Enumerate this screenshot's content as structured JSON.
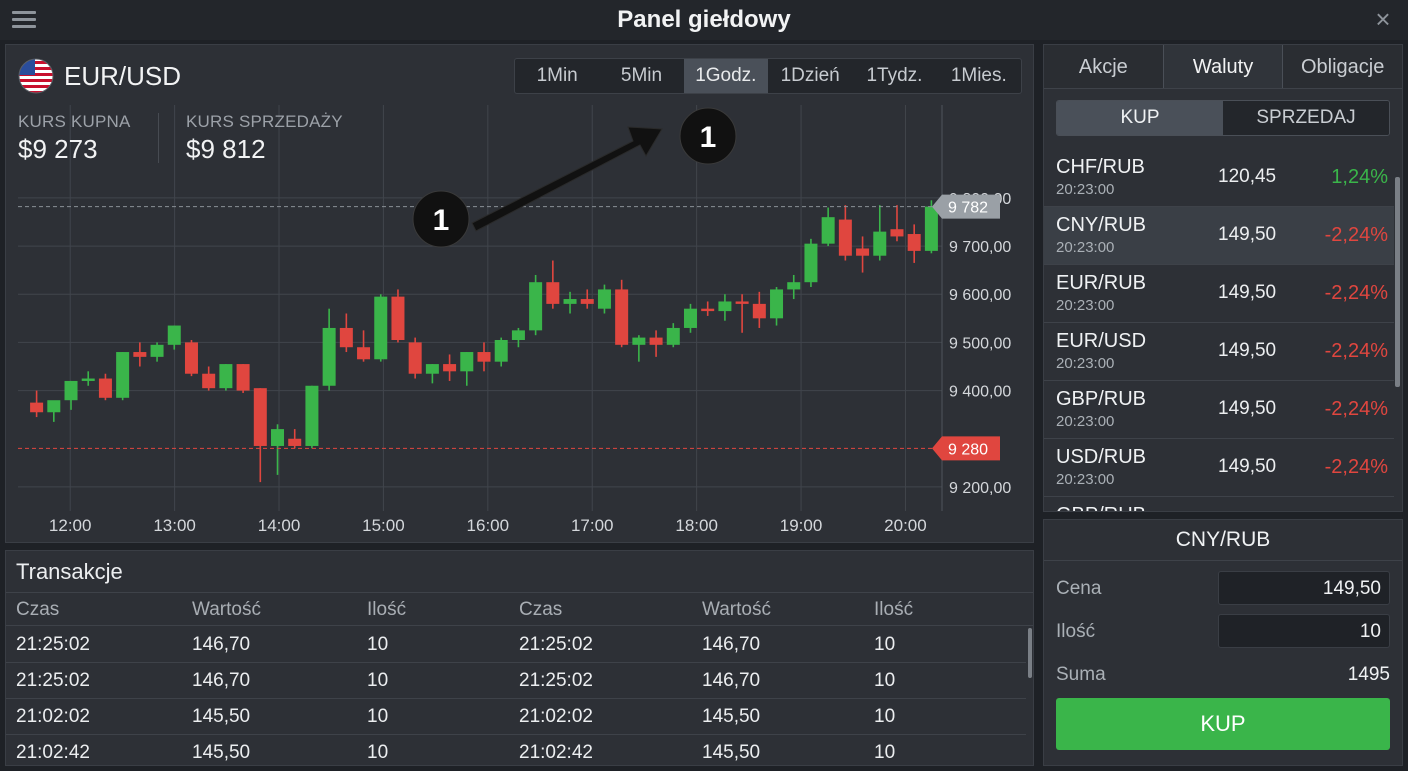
{
  "app": {
    "title": "Panel giełdowy"
  },
  "colors": {
    "up": "#3ab54a",
    "down": "#e0463f",
    "grid": "#41454c",
    "label_bg": "#9aa0a6",
    "callout": "#111111"
  },
  "chart_panel": {
    "pair": "EUR/USD",
    "timeframes": [
      {
        "label": "1Min",
        "active": false
      },
      {
        "label": "5Min",
        "active": false
      },
      {
        "label": "1Godz.",
        "active": true
      },
      {
        "label": "1Dzień",
        "active": false
      },
      {
        "label": "1Tydz.",
        "active": false
      },
      {
        "label": "1Mies.",
        "active": false
      }
    ],
    "buy_rate_label": "KURS KUPNA",
    "buy_rate_value": "$9 273",
    "sell_rate_label": "KURS SPRZEDAŻY",
    "sell_rate_value": "$9 812"
  },
  "chart_data": {
    "type": "candlestick",
    "x_labels": [
      "12:00",
      "13:00",
      "14:00",
      "15:00",
      "16:00",
      "17:00",
      "18:00",
      "19:00",
      "20:00"
    ],
    "y_ticks": [
      "9 800,00",
      "9 700,00",
      "9 600,00",
      "9 500,00",
      "9 400,00",
      "9 200,00"
    ],
    "y_tick_values": [
      9800,
      9700,
      9600,
      9500,
      9400,
      9200
    ],
    "ylim": [
      9150,
      9860
    ],
    "x_start_hour": 11.5,
    "x_end_hour": 20.35,
    "price_markers": [
      {
        "label": "9 782",
        "value": 9782,
        "kind": "current"
      },
      {
        "label": "9 280",
        "value": 9280,
        "kind": "low"
      }
    ],
    "candles": [
      {
        "o": 9375,
        "h": 9400,
        "l": 9345,
        "c": 9355
      },
      {
        "o": 9355,
        "h": 9375,
        "l": 9335,
        "c": 9380
      },
      {
        "o": 9380,
        "h": 9420,
        "l": 9360,
        "c": 9420
      },
      {
        "o": 9420,
        "h": 9440,
        "l": 9410,
        "c": 9425
      },
      {
        "o": 9425,
        "h": 9435,
        "l": 9380,
        "c": 9385
      },
      {
        "o": 9385,
        "h": 9480,
        "l": 9380,
        "c": 9480
      },
      {
        "o": 9480,
        "h": 9500,
        "l": 9450,
        "c": 9470
      },
      {
        "o": 9470,
        "h": 9500,
        "l": 9460,
        "c": 9495
      },
      {
        "o": 9495,
        "h": 9535,
        "l": 9485,
        "c": 9535
      },
      {
        "o": 9500,
        "h": 9505,
        "l": 9430,
        "c": 9435
      },
      {
        "o": 9435,
        "h": 9450,
        "l": 9400,
        "c": 9405
      },
      {
        "o": 9405,
        "h": 9455,
        "l": 9400,
        "c": 9455
      },
      {
        "o": 9455,
        "h": 9455,
        "l": 9395,
        "c": 9400
      },
      {
        "o": 9405,
        "h": 9405,
        "l": 9210,
        "c": 9285
      },
      {
        "o": 9285,
        "h": 9330,
        "l": 9225,
        "c": 9320
      },
      {
        "o": 9300,
        "h": 9320,
        "l": 9280,
        "c": 9285
      },
      {
        "o": 9285,
        "h": 9410,
        "l": 9280,
        "c": 9410
      },
      {
        "o": 9410,
        "h": 9570,
        "l": 9400,
        "c": 9530
      },
      {
        "o": 9530,
        "h": 9560,
        "l": 9480,
        "c": 9490
      },
      {
        "o": 9490,
        "h": 9525,
        "l": 9460,
        "c": 9465
      },
      {
        "o": 9465,
        "h": 9600,
        "l": 9460,
        "c": 9595
      },
      {
        "o": 9595,
        "h": 9610,
        "l": 9500,
        "c": 9505
      },
      {
        "o": 9500,
        "h": 9510,
        "l": 9425,
        "c": 9435
      },
      {
        "o": 9435,
        "h": 9455,
        "l": 9415,
        "c": 9455
      },
      {
        "o": 9455,
        "h": 9475,
        "l": 9420,
        "c": 9440
      },
      {
        "o": 9440,
        "h": 9480,
        "l": 9410,
        "c": 9480
      },
      {
        "o": 9480,
        "h": 9500,
        "l": 9440,
        "c": 9460
      },
      {
        "o": 9460,
        "h": 9510,
        "l": 9450,
        "c": 9505
      },
      {
        "o": 9505,
        "h": 9530,
        "l": 9490,
        "c": 9525
      },
      {
        "o": 9525,
        "h": 9640,
        "l": 9515,
        "c": 9625
      },
      {
        "o": 9625,
        "h": 9670,
        "l": 9570,
        "c": 9580
      },
      {
        "o": 9580,
        "h": 9605,
        "l": 9560,
        "c": 9590
      },
      {
        "o": 9590,
        "h": 9610,
        "l": 9570,
        "c": 9580
      },
      {
        "o": 9570,
        "h": 9620,
        "l": 9560,
        "c": 9610
      },
      {
        "o": 9610,
        "h": 9630,
        "l": 9490,
        "c": 9495
      },
      {
        "o": 9495,
        "h": 9515,
        "l": 9460,
        "c": 9510
      },
      {
        "o": 9510,
        "h": 9525,
        "l": 9470,
        "c": 9495
      },
      {
        "o": 9495,
        "h": 9540,
        "l": 9490,
        "c": 9530
      },
      {
        "o": 9530,
        "h": 9580,
        "l": 9520,
        "c": 9570
      },
      {
        "o": 9570,
        "h": 9585,
        "l": 9555,
        "c": 9565
      },
      {
        "o": 9565,
        "h": 9600,
        "l": 9545,
        "c": 9585
      },
      {
        "o": 9585,
        "h": 9600,
        "l": 9520,
        "c": 9580
      },
      {
        "o": 9580,
        "h": 9605,
        "l": 9530,
        "c": 9550
      },
      {
        "o": 9550,
        "h": 9615,
        "l": 9535,
        "c": 9610
      },
      {
        "o": 9610,
        "h": 9640,
        "l": 9590,
        "c": 9625
      },
      {
        "o": 9625,
        "h": 9715,
        "l": 9615,
        "c": 9705
      },
      {
        "o": 9705,
        "h": 9780,
        "l": 9700,
        "c": 9760
      },
      {
        "o": 9755,
        "h": 9785,
        "l": 9670,
        "c": 9680
      },
      {
        "o": 9695,
        "h": 9720,
        "l": 9645,
        "c": 9680
      },
      {
        "o": 9680,
        "h": 9785,
        "l": 9670,
        "c": 9730
      },
      {
        "o": 9735,
        "h": 9785,
        "l": 9710,
        "c": 9720
      },
      {
        "o": 9725,
        "h": 9745,
        "l": 9665,
        "c": 9690
      },
      {
        "o": 9690,
        "h": 9795,
        "l": 9685,
        "c": 9782
      }
    ]
  },
  "annotations": {
    "marker_1": "1",
    "marker_2": "1"
  },
  "trades": {
    "title": "Transakcje",
    "headers": [
      "Czas",
      "Wartość",
      "Ilość",
      "Czas",
      "Wartość",
      "Ilość"
    ],
    "rows": [
      [
        "21:25:02",
        "146,70",
        "10",
        "21:25:02",
        "146,70",
        "10"
      ],
      [
        "21:25:02",
        "146,70",
        "10",
        "21:25:02",
        "146,70",
        "10"
      ],
      [
        "21:02:02",
        "145,50",
        "10",
        "21:02:02",
        "145,50",
        "10"
      ],
      [
        "21:02:42",
        "145,50",
        "10",
        "21:02:42",
        "145,50",
        "10"
      ]
    ]
  },
  "market": {
    "tabs": [
      {
        "label": "Akcje",
        "active": false
      },
      {
        "label": "Waluty",
        "active": true
      },
      {
        "label": "Obligacje",
        "active": false
      }
    ],
    "buy_label": "KUP",
    "sell_label": "SPRZEDAJ",
    "pairs": [
      {
        "name": "CHF/RUB",
        "time": "20:23:00",
        "price": "120,45",
        "change": "1,24%",
        "dir": "up",
        "selected": false
      },
      {
        "name": "CNY/RUB",
        "time": "20:23:00",
        "price": "149,50",
        "change": "-2,24%",
        "dir": "down",
        "selected": true
      },
      {
        "name": "EUR/RUB",
        "time": "20:23:00",
        "price": "149,50",
        "change": "-2,24%",
        "dir": "down",
        "selected": false
      },
      {
        "name": "EUR/USD",
        "time": "20:23:00",
        "price": "149,50",
        "change": "-2,24%",
        "dir": "down",
        "selected": false
      },
      {
        "name": "GBP/RUB",
        "time": "20:23:00",
        "price": "149,50",
        "change": "-2,24%",
        "dir": "down",
        "selected": false
      },
      {
        "name": "USD/RUB",
        "time": "20:23:00",
        "price": "149,50",
        "change": "-2,24%",
        "dir": "down",
        "selected": false
      },
      {
        "name": "GBP/RUB",
        "time": "",
        "price": "",
        "change": "",
        "dir": "down",
        "selected": false
      }
    ]
  },
  "order": {
    "pair": "CNY/RUB",
    "price_label": "Cena",
    "price_value": "149,50",
    "qty_label": "Ilość",
    "qty_value": "10",
    "sum_label": "Suma",
    "sum_value": "1495",
    "submit_label": "KUP"
  }
}
